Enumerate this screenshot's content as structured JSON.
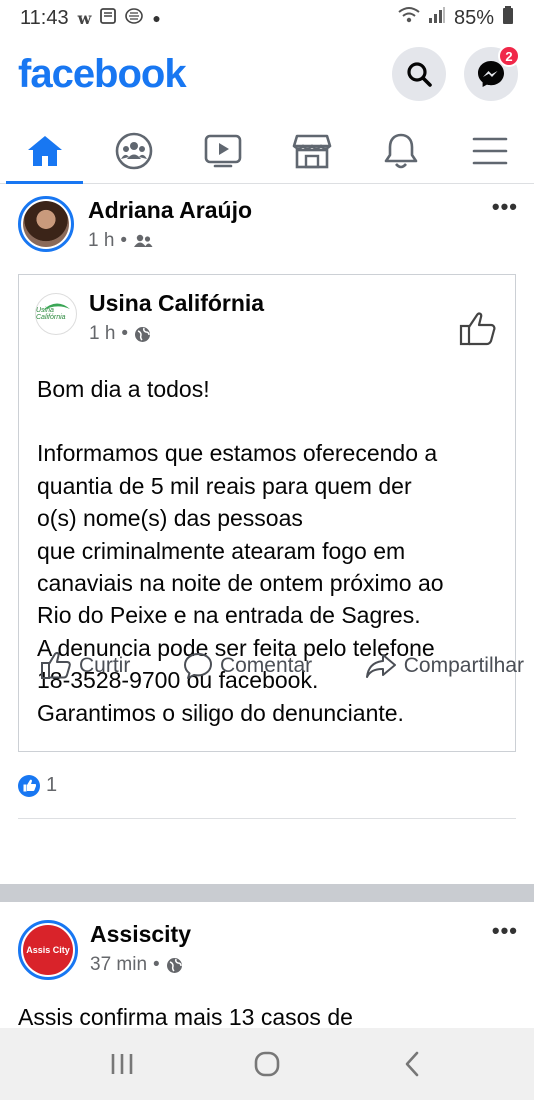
{
  "status_bar": {
    "time": "11:43",
    "battery": "85%",
    "notification_icons": [
      "w-icon",
      "message-icon",
      "instagram-like-icon"
    ]
  },
  "header": {
    "logo_text": "facebook",
    "messenger_badge": "2"
  },
  "tabs": [
    {
      "name": "home",
      "active": true
    },
    {
      "name": "groups",
      "active": false
    },
    {
      "name": "watch",
      "active": false
    },
    {
      "name": "marketplace",
      "active": false
    },
    {
      "name": "notifications",
      "active": false
    },
    {
      "name": "menu",
      "active": false
    }
  ],
  "post": {
    "author": "Adriana Araújo",
    "time": "1 h",
    "audience_icon": "friends-icon",
    "more_label": "•••",
    "shared": {
      "page_name": "Usina Califórnia",
      "page_logo_text": "Usina Califórnia",
      "time": "1 h",
      "audience_icon": "globe-icon",
      "greeting": "Bom dia a todos!",
      "lines": [
        "Informamos que estamos oferecendo a",
        "quantia de 5 mil reais para quem der",
        "o(s) nome(s) das pessoas",
        "que criminalmente atearam fogo em",
        "canaviais na noite de ontem próximo ao",
        "Rio do Peixe e na entrada de Sagres.",
        "A denuncia pode ser feita pelo telefone",
        "18-3528-9700 ou facebook.",
        "Garantimos o siligo do denunciante."
      ]
    },
    "reaction_count": "1",
    "actions": {
      "like": "Curtir",
      "comment": "Comentar",
      "share": "Compartilhar"
    }
  },
  "post2": {
    "author": "Assiscity",
    "time": "37 min",
    "audience_icon": "globe-icon",
    "more_label": "•••",
    "logo_text": "Assis City",
    "text": "Assis confirma mais 13 casos de"
  },
  "colors": {
    "brand": "#1877f2",
    "badge": "#f02849",
    "secondary_text": "#65676b"
  }
}
